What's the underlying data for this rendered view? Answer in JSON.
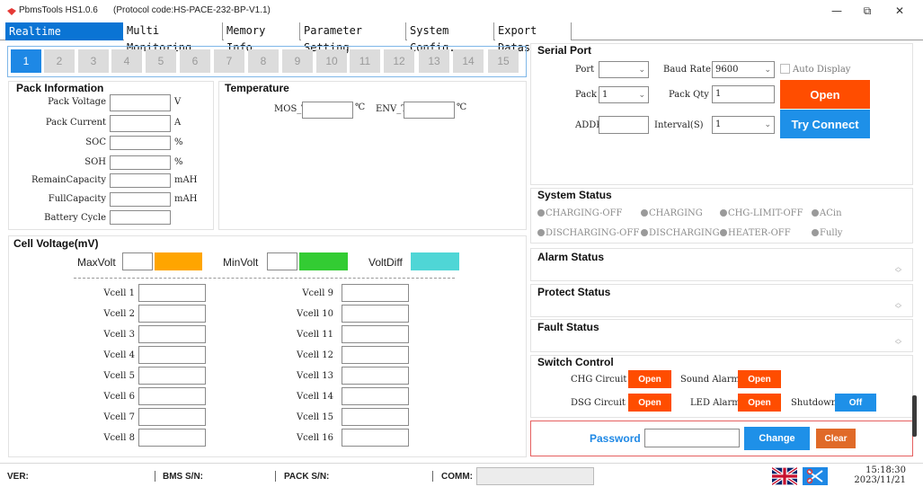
{
  "window": {
    "app_title": "PbmsTools HS1.0.6",
    "protocol": "(Protocol code:HS-PACE-232-BP-V1.1)",
    "minimize": "—",
    "restore": "⧉",
    "close": "✕"
  },
  "tabs": [
    "Realtime Monitoring",
    "Multi Monitoring",
    "Memory Info.",
    "Parameter Setting",
    "System Config.",
    "Export Datas"
  ],
  "pack_buttons": [
    "1",
    "2",
    "3",
    "4",
    "5",
    "6",
    "7",
    "8",
    "9",
    "10",
    "11",
    "12",
    "13",
    "14",
    "15"
  ],
  "pack_info": {
    "title": "Pack Information",
    "rows": [
      {
        "label": "Pack Voltage",
        "unit": "V"
      },
      {
        "label": "Pack Current",
        "unit": "A"
      },
      {
        "label": "SOC",
        "unit": "%"
      },
      {
        "label": "SOH",
        "unit": "%"
      },
      {
        "label": "RemainCapacity",
        "unit": "mAH"
      },
      {
        "label": "FullCapacity",
        "unit": "mAH"
      },
      {
        "label": "Battery Cycle",
        "unit": ""
      }
    ]
  },
  "temperature": {
    "title": "Temperature",
    "mos_label": "MOS_T",
    "env_label": "ENV_T",
    "unit": "℃"
  },
  "cell_voltage": {
    "title": "Cell Voltage(mV)",
    "max_label": "MaxVolt",
    "min_label": "MinVolt",
    "diff_label": "VoltDiff",
    "max_color": "#ffa500",
    "min_color": "#33cc33",
    "diff_color": "#4fd6d6",
    "cells": [
      "Vcell 1",
      "Vcell 2",
      "Vcell 3",
      "Vcell 4",
      "Vcell 5",
      "Vcell 6",
      "Vcell 7",
      "Vcell 8",
      "Vcell 9",
      "Vcell 10",
      "Vcell 11",
      "Vcell 12",
      "Vcell 13",
      "Vcell 14",
      "Vcell 15",
      "Vcell 16"
    ]
  },
  "serial_port": {
    "title": "Serial Port",
    "port_label": "Port",
    "port_value": "",
    "baud_label": "Baud Rate",
    "baud_value": "9600",
    "auto_display_label": "Auto Display",
    "auto_display_checked": false,
    "pack_label": "Pack",
    "pack_value": "1",
    "pack_qty_label": "Pack Qty",
    "pack_qty_value": "1",
    "open_label": "Open",
    "addr_label": "ADDR",
    "addr_value": "",
    "interval_label": "Interval(S)",
    "interval_value": "1",
    "try_connect_label": "Try Connect",
    "open_color": "#ff4d00",
    "try_color": "#1e90e8"
  },
  "system_status": {
    "title": "System Status",
    "items": [
      "CHARGING-OFF",
      "CHARGING",
      "CHG-LIMIT-OFF",
      "ACin",
      "DISCHARGING-OFF",
      "DISCHARGING",
      "HEATER-OFF",
      "Fully"
    ]
  },
  "alarm_status": {
    "title": "Alarm Status"
  },
  "protect_status": {
    "title": "Protect Status"
  },
  "fault_status": {
    "title": "Fault Status"
  },
  "switch_control": {
    "title": "Switch Control",
    "chg_label": "CHG Circuit",
    "chg_btn": "Open",
    "sound_label": "Sound Alarm",
    "sound_btn": "Open",
    "dsg_label": "DSG Circuit",
    "dsg_btn": "Open",
    "led_label": "LED Alarm",
    "led_btn": "Open",
    "shutdown_label": "Shutdown",
    "shutdown_btn": "Off"
  },
  "password": {
    "label": "Password",
    "value": "",
    "change_label": "Change",
    "clear_label": "Clear"
  },
  "statusbar": {
    "ver_label": "VER:",
    "bms_label": "BMS S/N:",
    "pack_label": "PACK S/N:",
    "comm_label": "COMM:",
    "time": "15:18:30",
    "date": "2023/11/21"
  }
}
